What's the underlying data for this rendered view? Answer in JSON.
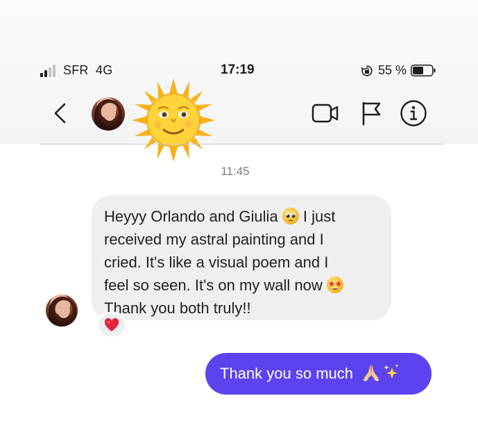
{
  "status_bar": {
    "carrier": "SFR",
    "network": "4G",
    "time": "17:19",
    "battery": "55 %",
    "signal_bars_filled": 2,
    "signal_bars_total": 4,
    "battery_level": 0.55,
    "icons": [
      "signal-icon",
      "orientation-lock-icon",
      "battery-icon"
    ]
  },
  "header": {
    "icons": [
      "back-chevron-icon",
      "contact-avatar",
      "sun-emoji-icon",
      "video-call-icon",
      "flag-icon",
      "info-icon"
    ]
  },
  "conversation": {
    "timestamp": "11:45",
    "incoming": {
      "line1": "Heyyy Orlando and Giulia",
      "line1_tail": " I just",
      "line2": "received my astral painting and I",
      "line3": "cried. It's like a visual poem and I",
      "line4": "feel so seen. It's on my wall now",
      "line5": "Thank you both truly!!",
      "emojis": [
        "pleading-face-emoji",
        "star-struck-emoji"
      ],
      "reaction": "heart-icon"
    },
    "outgoing": {
      "text": "Thank you so much",
      "emojis": [
        "praying-hands-emoji",
        "sparkles-emoji"
      ]
    }
  },
  "colors": {
    "outgoing_bubble": "#5b43f0",
    "incoming_bubble": "#efeff2",
    "header_background": "#f6f6f6",
    "reaction_heart": "#e0243a"
  }
}
